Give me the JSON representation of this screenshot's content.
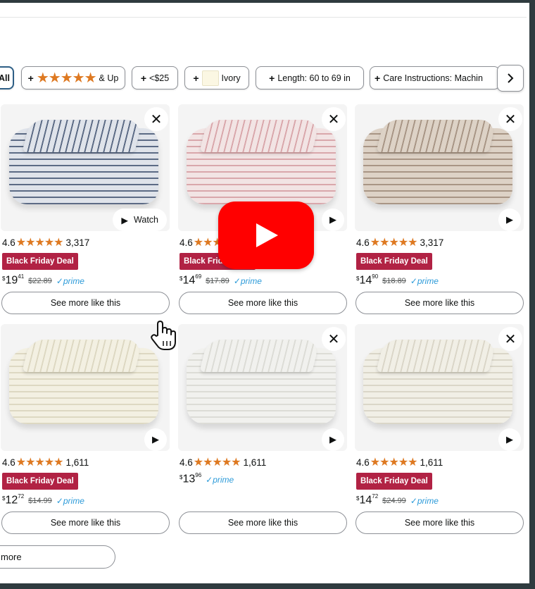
{
  "filters": {
    "chips": [
      {
        "id": "all",
        "label": "All"
      },
      {
        "id": "rating",
        "label": "& Up",
        "icon": "stars-icon",
        "stars": 4
      },
      {
        "id": "price",
        "label": "<$25"
      },
      {
        "id": "color",
        "label": "Ivory",
        "icon": "color-swatch-icon",
        "swatch_color": "#fbf7e3"
      },
      {
        "id": "length",
        "label": "Length: 60 to 69 in"
      },
      {
        "id": "care",
        "label": "Care Instructions: Machin"
      }
    ],
    "plus": "+",
    "next_icon": "chevron-right-icon"
  },
  "products": [
    {
      "rating": "4.6",
      "stars": "★★★★★",
      "reviews": "3,317",
      "deal": "Black Friday Deal",
      "price_whole": "19",
      "price_frac": "41",
      "list_price": "$22.89",
      "prime": "✓prime",
      "see_more": "See more like this",
      "close": "✕",
      "media": "Watch",
      "colors": {
        "base": "#dfe3ea",
        "stripe": "#5c6b85"
      }
    },
    {
      "rating": "4.6",
      "stars": "★★★★★",
      "reviews": "",
      "deal": "Black Friday Deal",
      "price_whole": "14",
      "price_frac": "69",
      "list_price": "$17.89",
      "prime": "✓prime",
      "see_more": "See more like this",
      "close": "✕",
      "media": "",
      "colors": {
        "base": "#f2e4e4",
        "stripe": "#d9a7ab"
      }
    },
    {
      "rating": "4.6",
      "stars": "★★★★★",
      "reviews": "3,317",
      "deal": "Black Friday Deal",
      "price_whole": "14",
      "price_frac": "90",
      "list_price": "$18.89",
      "prime": "✓prime",
      "see_more": "See more like this",
      "close": "✕",
      "media": "",
      "colors": {
        "base": "#ddd2c6",
        "stripe": "#a89585"
      }
    },
    {
      "rating": "4.6",
      "stars": "★★★★★",
      "reviews": "1,611",
      "deal": "Black Friday Deal",
      "price_whole": "12",
      "price_frac": "72",
      "list_price": "$14.99",
      "prime": "✓prime",
      "see_more": "See more like this",
      "close": "",
      "media": "",
      "colors": {
        "base": "#f3f0e2",
        "stripe": "#ddd8c2"
      }
    },
    {
      "rating": "4.6",
      "stars": "★★★★★",
      "reviews": "1,611",
      "deal": "",
      "price_whole": "13",
      "price_frac": "96",
      "list_price": "",
      "prime": "✓prime",
      "see_more": "See more like this",
      "close": "✕",
      "media": "",
      "colors": {
        "base": "#f1f1ee",
        "stripe": "#dcdcd6"
      }
    },
    {
      "rating": "4.6",
      "stars": "★★★★★",
      "reviews": "1,611",
      "deal": "Black Friday Deal",
      "price_whole": "14",
      "price_frac": "72",
      "list_price": "$24.99",
      "prime": "✓prime",
      "see_more": "See more like this",
      "close": "✕",
      "media": "",
      "colors": {
        "base": "#f1efe6",
        "stripe": "#dad6c8"
      }
    }
  ],
  "more_button": "more",
  "overlay": {
    "icon": "youtube-play-icon",
    "cursor": "hand-cursor-icon"
  },
  "colors": {
    "deal_badge": "#b12244",
    "star": "#de7921",
    "prime": "#2d9bd9",
    "youtube": "#ff0000"
  }
}
